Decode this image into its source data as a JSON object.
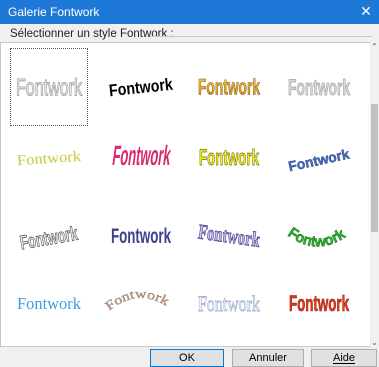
{
  "window": {
    "title": "Galerie Fontwork",
    "close_symbol": "✕"
  },
  "group_label": "Sélectionner un style Fontwork :",
  "gallery": [
    {
      "text": "Fontwork"
    },
    {
      "text": "Fontwork"
    },
    {
      "text": "Fontwork"
    },
    {
      "text": "Fontwork"
    },
    {
      "text": "Fontwork"
    },
    {
      "text": "Fontwork"
    },
    {
      "text": "Fontwork"
    },
    {
      "text": "Fontwork"
    },
    {
      "text": "Fontwork"
    },
    {
      "text": "Fontwork"
    },
    {
      "text": "Fontwork"
    },
    {
      "text": "Fontwork"
    },
    {
      "text": "Fontwork"
    },
    {
      "text": "Fontwork"
    },
    {
      "text": "Fontwork"
    },
    {
      "text": "Fontwork"
    }
  ],
  "buttons": {
    "ok": "OK",
    "annuler": "Annuler",
    "aide": "Aide"
  },
  "colors": {
    "titlebar": "#1e78d7"
  }
}
